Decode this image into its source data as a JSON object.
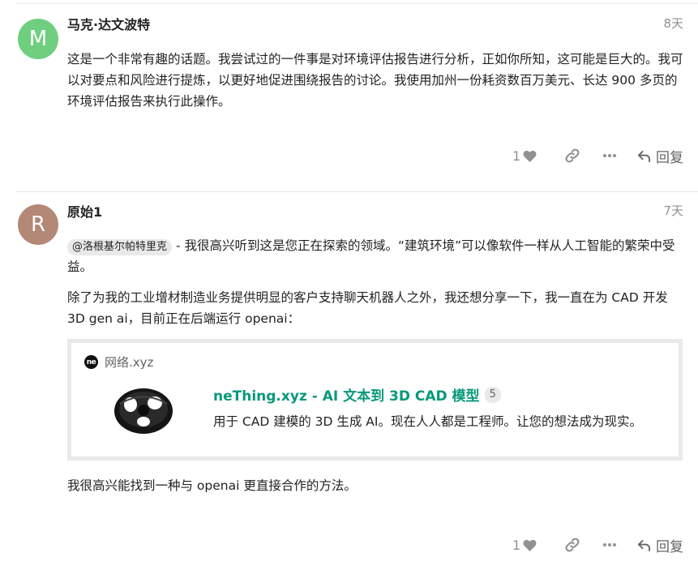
{
  "posts": [
    {
      "avatar_letter": "M",
      "avatar_color": "#6fcf7f",
      "username": "马克·达文波特",
      "time": "8天",
      "paragraphs": [
        "这是一个非常有趣的话题。我尝试过的一件事是对环境评估报告进行分析，正如你所知，这可能是巨大的。我可以对要点和风险进行提炼，以更好地促进围绕报告的讨论。我使用加州一份耗资数百万美元、长达 900 多页的环境评估报告来执行此操作。"
      ],
      "actions": {
        "like_count": "1",
        "reply_label": "回复"
      }
    },
    {
      "avatar_letter": "R",
      "avatar_color": "#b38876",
      "username": "原始1",
      "time": "7天",
      "mention": "@洛根基尔帕特里克",
      "paragraphs": [
        " - 我很高兴听到这是您正在探索的领域。“建筑环境”可以像软件一样从人工智能的繁荣中受益。",
        "除了为我的工业增材制造业务提供明显的客户支持聊天机器人之外，我还想分享一下，我一直在为 CAD 开发 3D gen ai，目前正在后端运行 openai：",
        "我很高兴能找到一种与 openai 更直接合作的方法。"
      ],
      "onebox": {
        "favicon_text": "ne",
        "source": "网络.xyz",
        "title": "neThing.xyz - AI 文本到 3D CAD 模型",
        "click_count": "5",
        "description": "用于 CAD 建模的 3D 生成 AI。现在人人都是工程师。让您的想法成为现实。"
      },
      "actions": {
        "like_count": "1",
        "reply_label": "回复"
      }
    }
  ],
  "colors": {
    "link_title": "#08997a",
    "muted": "#919191",
    "border": "#e9e9e9"
  },
  "icons": [
    "heart-icon",
    "link-icon",
    "ellipsis-icon",
    "reply-arrow-icon",
    "site-favicon"
  ]
}
